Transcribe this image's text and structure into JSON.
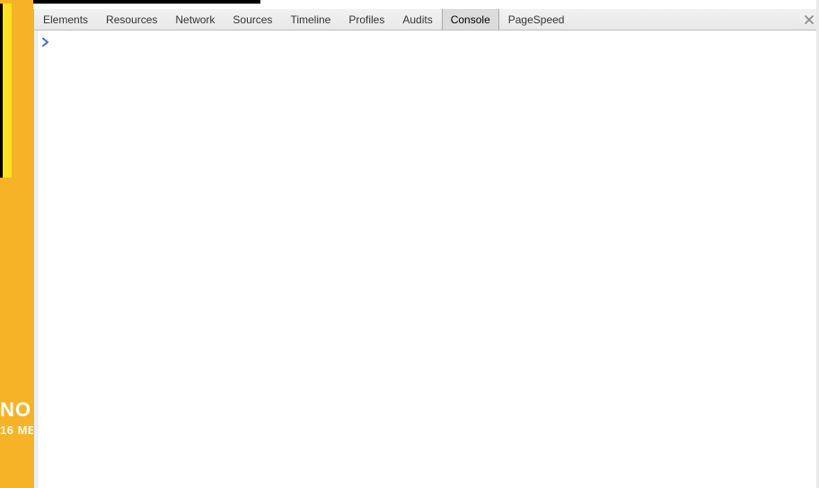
{
  "page": {
    "bg_fragment_line1": "NO",
    "bg_fragment_line2": "16 ME"
  },
  "devtools": {
    "tabs": [
      {
        "label": "Elements",
        "active": false
      },
      {
        "label": "Resources",
        "active": false
      },
      {
        "label": "Network",
        "active": false
      },
      {
        "label": "Sources",
        "active": false
      },
      {
        "label": "Timeline",
        "active": false
      },
      {
        "label": "Profiles",
        "active": false
      },
      {
        "label": "Audits",
        "active": false
      },
      {
        "label": "Console",
        "active": true
      },
      {
        "label": "PageSpeed",
        "active": false
      }
    ],
    "close_tooltip": "Close",
    "console": {
      "prompt_value": "",
      "prompt_placeholder": ""
    }
  }
}
